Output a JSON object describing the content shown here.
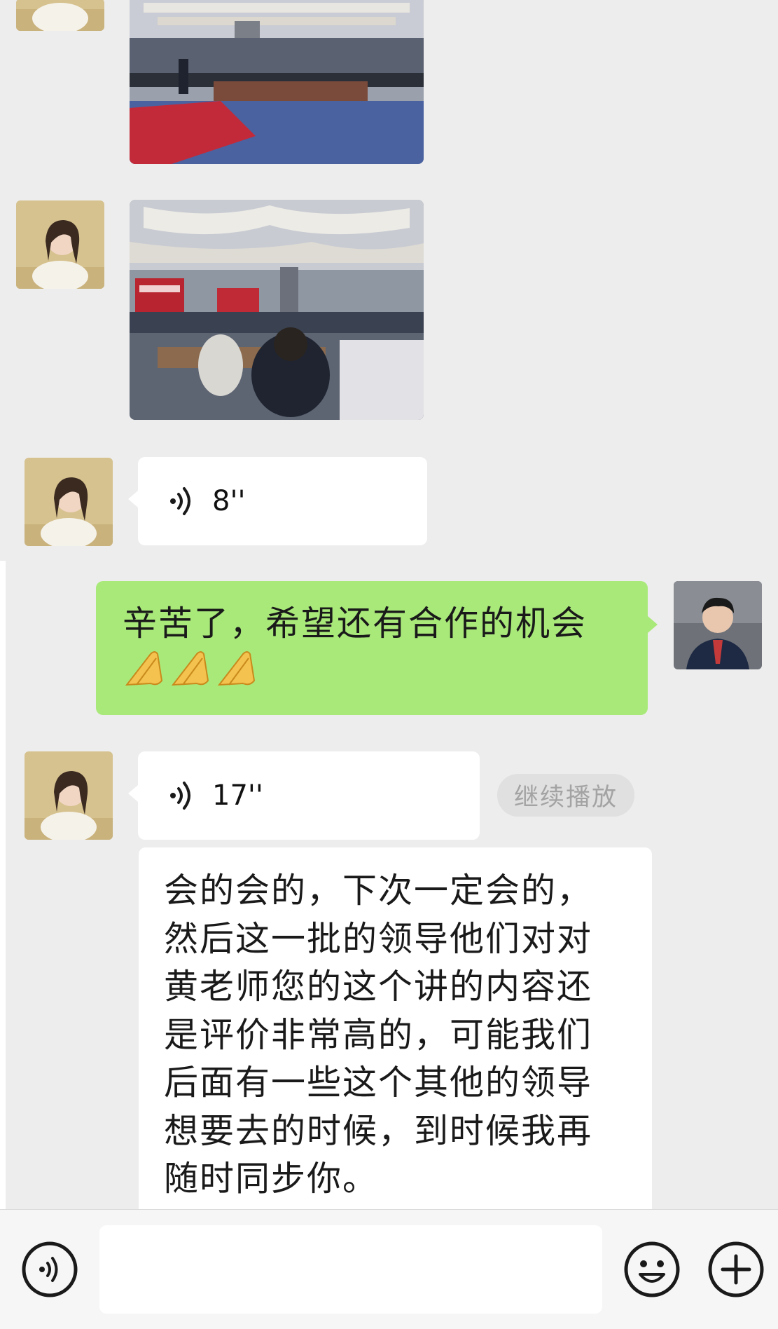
{
  "messages": {
    "incoming_voice_1": {
      "duration": "8''"
    },
    "outgoing_text": {
      "text": "辛苦了，希望还有合作的机会",
      "emoji": "🙏🙏🙏"
    },
    "incoming_voice_2": {
      "duration": "17''",
      "resume_label": "继续播放"
    },
    "transcript": "会的会的，下次一定会的，然后这一批的领导他们对对黄老师您的这个讲的内容还是评价非常高的，可能我们后面有一些这个其他的领导想要去的时候，到时候我再随时同步你。"
  },
  "input_bar": {
    "placeholder": "",
    "value": ""
  },
  "icons": {
    "voice_toggle": "voice-mode-icon",
    "emoji": "emoji-icon",
    "more": "plus-icon",
    "voice_wave": "voice-wave-icon"
  },
  "colors": {
    "background": "#ededed",
    "outgoing_bubble": "#a9e97a",
    "incoming_bubble": "#ffffff",
    "resume_chip": "#e0e0e0"
  }
}
